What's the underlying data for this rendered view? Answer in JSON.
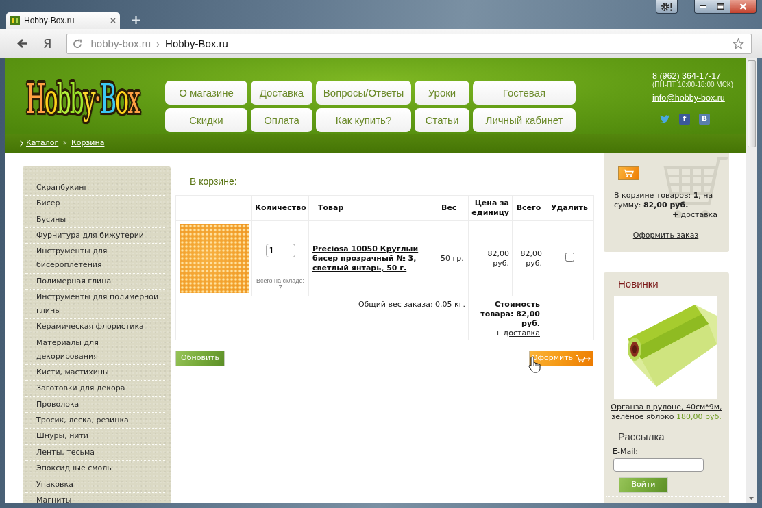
{
  "browser": {
    "tab_title": "Hobby-Box.ru",
    "home_button": "Я",
    "address": {
      "domain": "hobby-box.ru",
      "separator": "›",
      "page_title": "Hobby-Box.ru"
    }
  },
  "header": {
    "logo": "Hobby·Box",
    "nav_rows": [
      [
        "О магазине",
        "Доставка",
        "Вопросы/Ответы",
        "Уроки",
        "Гостевая"
      ],
      [
        "Скидки",
        "Оплата",
        "Как купить?",
        "Статьи",
        "Личный кабинет"
      ]
    ],
    "contact": {
      "phone": "8 (962) 364-17-17",
      "hours": "(ПН-ПТ 10:00-18:00 МСК)",
      "email": "info@hobby-box.ru"
    },
    "social": [
      {
        "kind": "bird",
        "color": "#4aa9e2"
      },
      {
        "kind": "tile",
        "label": "f",
        "color": "#3b5998"
      },
      {
        "kind": "tile",
        "label": "B",
        "color": "#5a7fae"
      }
    ]
  },
  "breadcrumb": {
    "items": [
      "Каталог",
      "Корзина"
    ],
    "separator": "»"
  },
  "sidebar": {
    "categories": [
      "Скрапбукинг",
      "Бисер",
      "Бусины",
      "Фурнитура для бижутерии",
      "Инструменты для бисероплетения",
      "Полимерная глина",
      "Инструменты для полимерной глины",
      "Керамическая флористика",
      "Материалы для декорирования",
      "Кисти, мастихины",
      "Заготовки для декора",
      "Проволока",
      "Тросик, леска, резинка",
      "Шнуры, нити",
      "Ленты, тесьма",
      "Эпоксидные смолы",
      "Упаковка",
      "Магниты"
    ]
  },
  "cart": {
    "title": "В корзине:",
    "columns": [
      "Количество",
      "Товар",
      "Вес",
      "Цена за единицу",
      "Всего",
      "Удалить"
    ],
    "rows": [
      {
        "quantity": "1",
        "stock": "Всего на складе: 7",
        "name": "Preciosa 10050 Круглый бисер прозрачный № 3, светлый янтарь, 50 г.",
        "weight": "50 гр.",
        "price": "82,00 руб.",
        "total": "82,00 руб.",
        "remove": false
      }
    ],
    "total_weight": "Общий вес заказа: 0.05 кг.",
    "cost": "Стоимость товара: 82,00 руб.",
    "delivery": {
      "prefix": "+",
      "link": "доставка"
    },
    "update_button": "Обновить",
    "checkout_button": "Оформить"
  },
  "cart_widget": {
    "link": "В корзине",
    "summary": "товаров: **1**, на сумму: **82,00 руб.**",
    "delivery": {
      "prefix": "+",
      "link": "доставка"
    },
    "checkout_link": "Оформить заказ"
  },
  "new_products": {
    "title": "Новинки",
    "item": {
      "name": "Органза в рулоне, 40см*9м, зелёное яблоко",
      "price": "180,00 руб."
    }
  },
  "newsletter": {
    "title": "Рассылка",
    "label": "E-Mail:",
    "button": "Войти"
  }
}
